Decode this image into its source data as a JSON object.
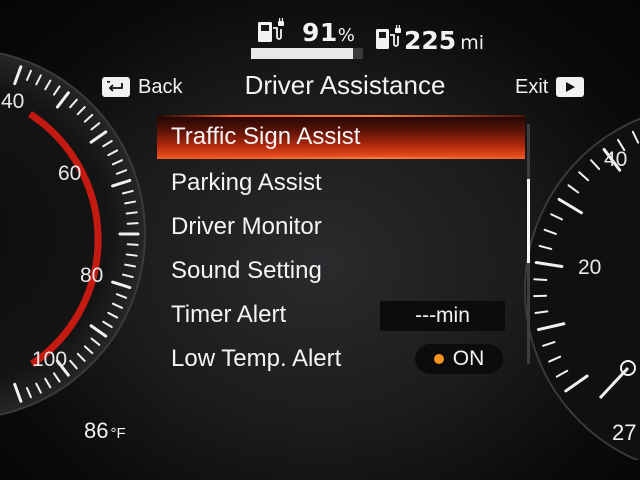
{
  "status": {
    "battery_percent": "91",
    "battery_unit": "%",
    "battery_level": 0.91,
    "range_value": "225",
    "range_unit": "mi"
  },
  "header": {
    "back_label": "Back",
    "title": "Driver Assistance",
    "exit_label": "Exit"
  },
  "menu": {
    "items": [
      {
        "label": "Traffic Sign Assist",
        "selected": true
      },
      {
        "label": "Parking Assist"
      },
      {
        "label": "Driver Monitor"
      },
      {
        "label": "Sound Setting"
      },
      {
        "label": "Timer Alert",
        "value": "---min"
      },
      {
        "label": "Low Temp. Alert",
        "value": "ON"
      }
    ],
    "scroll_position": 0.35,
    "scroll_fraction": 0.35
  },
  "left_gauge": {
    "labels": [
      "40",
      "60",
      "80",
      "100"
    ],
    "accent_color": "#c41a12"
  },
  "right_gauge": {
    "labels": [
      "40",
      "20"
    ],
    "readout": "27"
  },
  "outside_temp": {
    "value": "86",
    "unit": "°F"
  },
  "colors": {
    "selection": "#d23a14",
    "toggle_on": "#f7931e",
    "text": "#f2f2f2"
  },
  "icons": {
    "battery": "ev-charge-plug-icon",
    "range": "ev-range-plug-icon",
    "back": "back-return-icon",
    "exit": "play-exit-icon"
  }
}
